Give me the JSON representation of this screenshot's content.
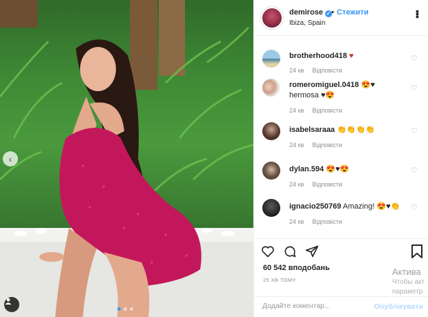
{
  "colors": {
    "accent": "#3897f0",
    "heart_red": "#c0392b",
    "dress_pink": "#c2185b",
    "foliage": "#3f8a35"
  },
  "header": {
    "username": "demirose",
    "follow_separator": "•",
    "follow_label": "Стежити",
    "location": "Ibiza, Spain",
    "more_icon": "more-horizontal-icon"
  },
  "comments": [
    {
      "user": "brotherhood418",
      "text": "♥",
      "time": "24 кв",
      "reply": "Відповісти"
    },
    {
      "user": "romeromiguel.0418",
      "text": "😍♥ hermosa ♥😍",
      "time": "24 кв",
      "reply": "Відповісти"
    },
    {
      "user": "isabelsaraaa",
      "text": "👏👏👏👏",
      "time": "24 кв",
      "reply": "Відповісти"
    },
    {
      "user": "dylan.594",
      "text": "😍♥😍",
      "time": "24 кв",
      "reply": "Відповісти"
    },
    {
      "user": "ignacio250769",
      "text": "Amazing! 😍♥👏",
      "time": "24 кв",
      "reply": "Відповісти"
    }
  ],
  "actions": {
    "likes": "60 542 вподобань",
    "time_ago": "25 ХВ ТОМУ",
    "add_comment_placeholder": "Додайте коментар...",
    "post_label": "Опублікувати"
  },
  "watermark": {
    "line1": "Актива",
    "line2": "Чтобы акт",
    "line3": "параметр"
  },
  "carousel": {
    "slides": 3,
    "active_index": 0
  }
}
